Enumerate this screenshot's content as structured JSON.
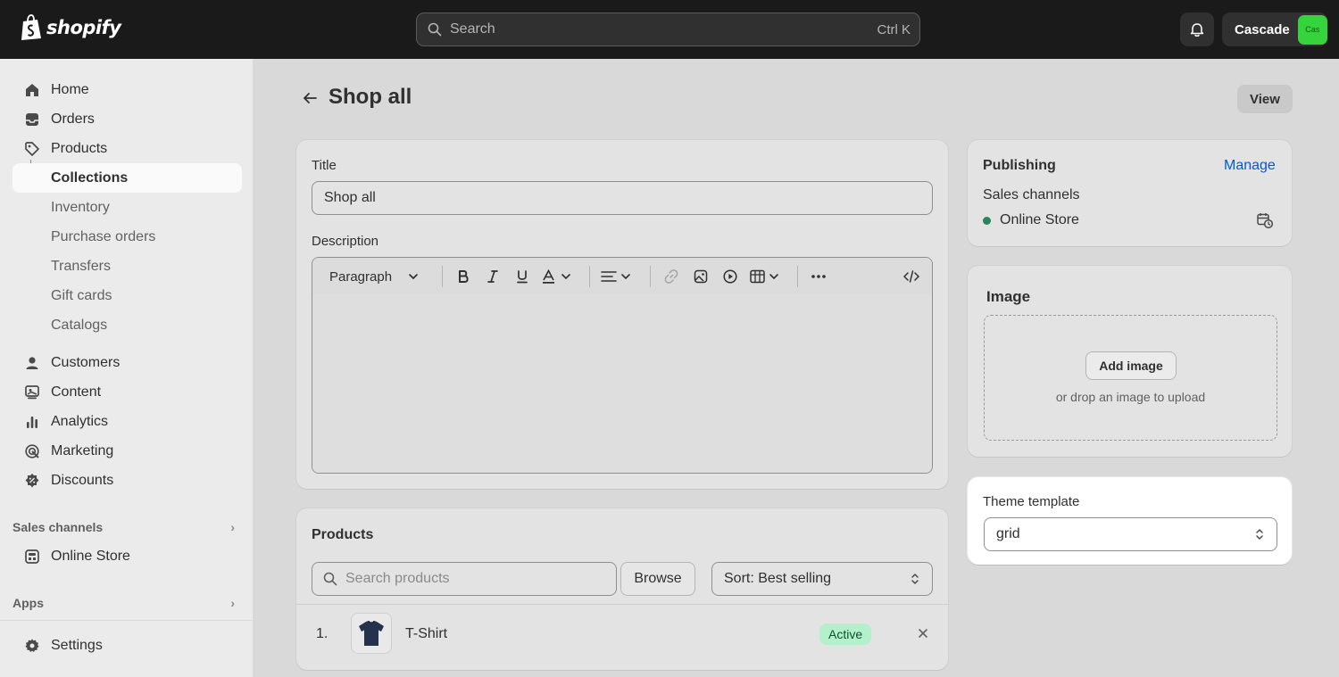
{
  "topbar": {
    "logo_text": "shopify",
    "search_placeholder": "Search",
    "search_shortcut": "Ctrl K",
    "store_name": "Cascade",
    "store_avatar_text": "Cas",
    "colors": {
      "bar": "#1a1a1a",
      "avatar": "#36d33c"
    }
  },
  "sidebar": {
    "items": [
      {
        "label": "Home",
        "icon": "home-icon"
      },
      {
        "label": "Orders",
        "icon": "inbox-icon"
      },
      {
        "label": "Products",
        "icon": "tag-icon"
      },
      {
        "label": "Collections",
        "active": true
      },
      {
        "label": "Inventory"
      },
      {
        "label": "Purchase orders"
      },
      {
        "label": "Transfers"
      },
      {
        "label": "Gift cards"
      },
      {
        "label": "Catalogs"
      },
      {
        "label": "Customers",
        "icon": "person-icon"
      },
      {
        "label": "Content",
        "icon": "content-icon"
      },
      {
        "label": "Analytics",
        "icon": "bar-chart-icon"
      },
      {
        "label": "Marketing",
        "icon": "target-icon"
      },
      {
        "label": "Discounts",
        "icon": "discount-icon"
      }
    ],
    "sales_channels_heading": "Sales channels",
    "online_store": "Online Store",
    "apps_heading": "Apps",
    "settings": "Settings"
  },
  "page": {
    "title": "Shop all",
    "view_button": "View"
  },
  "details": {
    "title_label": "Title",
    "title_value": "Shop all",
    "description_label": "Description",
    "editor": {
      "block_format": "Paragraph",
      "body": ""
    }
  },
  "products": {
    "heading": "Products",
    "search_placeholder": "Search products",
    "browse_button": "Browse",
    "sort_value": "Sort: Best selling",
    "rows": [
      {
        "index": "1.",
        "name": "T-Shirt",
        "status": "Active"
      }
    ]
  },
  "publishing": {
    "heading": "Publishing",
    "manage_link": "Manage",
    "sales_channels_label": "Sales channels",
    "channel": "Online Store",
    "channel_status_color": "#29845a"
  },
  "image": {
    "heading": "Image",
    "add_button": "Add image",
    "drop_hint": "or drop an image to upload"
  },
  "theme_template": {
    "label": "Theme template",
    "value": "grid"
  }
}
